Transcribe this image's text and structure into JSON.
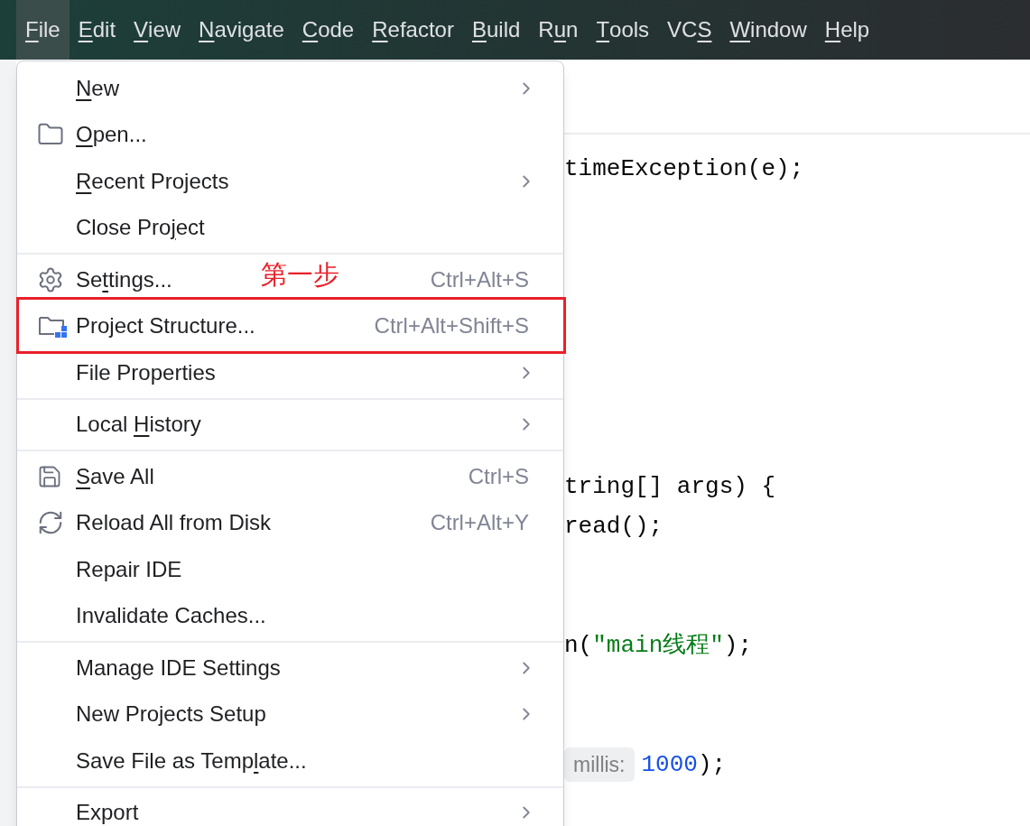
{
  "menu_bar": [
    {
      "key": "F",
      "post": "ile",
      "selected": true
    },
    {
      "key": "E",
      "post": "dit",
      "selected": false
    },
    {
      "key": "V",
      "post": "iew",
      "selected": false
    },
    {
      "key": "N",
      "post": "avigate",
      "selected": false
    },
    {
      "key": "C",
      "post": "ode",
      "selected": false
    },
    {
      "key": "R",
      "post": "efactor",
      "selected": false
    },
    {
      "key": "B",
      "post": "uild",
      "selected": false
    },
    {
      "pre": "R",
      "key": "u",
      "post": "n",
      "selected": false
    },
    {
      "key": "T",
      "post": "ools",
      "selected": false
    },
    {
      "pre": "VC",
      "key": "S",
      "selected": false
    },
    {
      "key": "W",
      "post": "indow",
      "selected": false
    },
    {
      "key": "H",
      "post": "elp",
      "selected": false
    }
  ],
  "file_menu": [
    {
      "kind": "item",
      "key": "N",
      "post": "ew",
      "submenu": true
    },
    {
      "kind": "folder-item",
      "key": "O",
      "post": "pen...",
      "submenu": false
    },
    {
      "kind": "item",
      "key": "R",
      "post": "ecent Projects",
      "submenu": true
    },
    {
      "kind": "item",
      "pre": "Close Pro",
      "key": "j",
      "post": "ect",
      "submenu": false
    },
    {
      "kind": "separator"
    },
    {
      "kind": "gear-item",
      "pre": "Se",
      "key": "t",
      "post": "tings...",
      "shortcut": "Ctrl+Alt+S",
      "submenu": false
    },
    {
      "kind": "project-item",
      "pre": "Project Structure...",
      "shortcut": "Ctrl+Alt+Shift+S",
      "submenu": false,
      "highlighted": true
    },
    {
      "kind": "item",
      "pre": "File Properties",
      "submenu": true
    },
    {
      "kind": "separator"
    },
    {
      "kind": "item",
      "pre": "Local ",
      "key": "H",
      "post": "istory",
      "submenu": true
    },
    {
      "kind": "separator"
    },
    {
      "kind": "save-item",
      "key": "S",
      "post": "ave All",
      "shortcut": "Ctrl+S",
      "submenu": false
    },
    {
      "kind": "reload-item",
      "pre": "Reload All from Disk",
      "shortcut": "Ctrl+Alt+Y",
      "submenu": false
    },
    {
      "kind": "item",
      "pre": "Repair IDE",
      "submenu": false
    },
    {
      "kind": "item",
      "pre": "Invalidate Caches...",
      "submenu": false
    },
    {
      "kind": "separator"
    },
    {
      "kind": "item",
      "pre": "Manage IDE Settings",
      "submenu": true
    },
    {
      "kind": "item",
      "pre": "New Projects Setup",
      "submenu": true
    },
    {
      "kind": "item",
      "pre": "Save File as Temp",
      "key": "l",
      "post": "ate...",
      "submenu": false
    },
    {
      "kind": "separator"
    },
    {
      "kind": "item",
      "pre": "Export",
      "submenu": true
    }
  ],
  "annotation": {
    "text": "第一步"
  },
  "editor_lines": [
    {
      "kind": "code",
      "segments": [
        {
          "kind": "plain",
          "text": "timeException(e);"
        }
      ]
    },
    {
      "kind": "blank"
    },
    {
      "kind": "blank"
    },
    {
      "kind": "blank"
    },
    {
      "kind": "blank"
    },
    {
      "kind": "blank"
    },
    {
      "kind": "blank"
    },
    {
      "kind": "blank"
    },
    {
      "kind": "code",
      "segments": [
        {
          "kind": "plain",
          "text": "tring[] args) {"
        }
      ]
    },
    {
      "kind": "code",
      "segments": [
        {
          "kind": "plain",
          "text": "read();"
        }
      ]
    },
    {
      "kind": "blank"
    },
    {
      "kind": "blank"
    },
    {
      "kind": "code",
      "segments": [
        {
          "kind": "plain",
          "text": "n("
        },
        {
          "kind": "string",
          "text": "\"main线程\""
        },
        {
          "kind": "plain",
          "text": ");"
        }
      ]
    },
    {
      "kind": "blank"
    },
    {
      "kind": "blank"
    },
    {
      "kind": "code",
      "segments": [
        {
          "kind": "hint",
          "text": "millis:"
        },
        {
          "kind": "number",
          "text": "1000"
        },
        {
          "kind": "plain",
          "text": ");"
        }
      ]
    }
  ]
}
